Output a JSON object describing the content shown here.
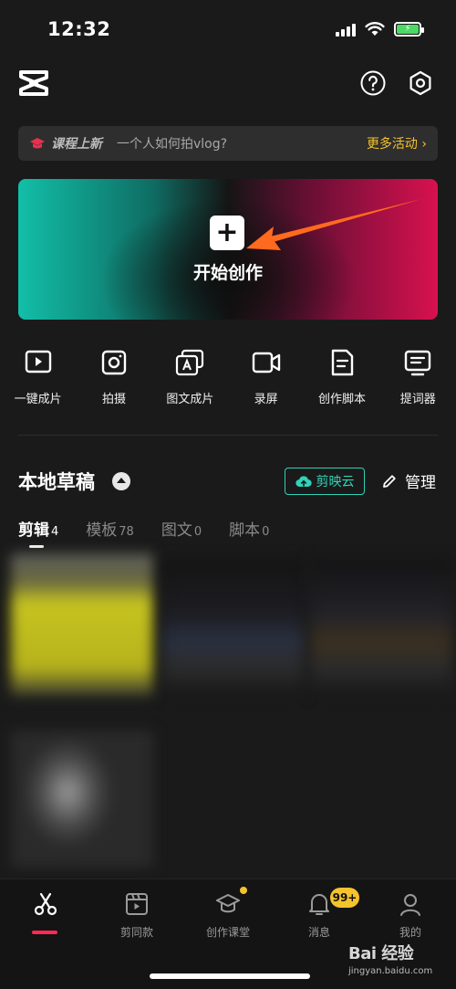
{
  "status_bar": {
    "time": "12:32",
    "battery_level": 0.85
  },
  "header": {
    "logo_icon": "capcut-logo-icon",
    "help_icon": "help-icon",
    "settings_icon": "settings-icon"
  },
  "banner": {
    "tag": "课程上新",
    "course": "一个人如何拍vlog?",
    "more": "更多活动 ›"
  },
  "create": {
    "plus": "+",
    "label": "开始创作"
  },
  "tools": [
    {
      "label": "一键成片",
      "icon": "play-icon"
    },
    {
      "label": "拍摄",
      "icon": "camera-icon"
    },
    {
      "label": "图文成片",
      "icon": "image-text-icon"
    },
    {
      "label": "录屏",
      "icon": "screen-record-icon"
    },
    {
      "label": "创作脚本",
      "icon": "script-icon"
    },
    {
      "label": "提词器",
      "icon": "teleprompter-icon"
    }
  ],
  "drafts": {
    "title": "本地草稿",
    "cloud": "剪映云",
    "manage": "管理",
    "tabs": [
      {
        "name": "剪辑",
        "count": "4"
      },
      {
        "name": "模板",
        "count": "78"
      },
      {
        "name": "图文",
        "count": "0"
      },
      {
        "name": "脚本",
        "count": "0"
      }
    ]
  },
  "bottom_nav": [
    {
      "label": "",
      "icon": "scissors-icon"
    },
    {
      "label": "剪同款",
      "icon": "template-icon"
    },
    {
      "label": "创作课堂",
      "icon": "graduation-cap-icon"
    },
    {
      "label": "消息",
      "icon": "bell-icon"
    },
    {
      "label": "我的",
      "icon": "profile-icon"
    }
  ],
  "badge": "99+",
  "watermark": {
    "logo": "Bai 经验",
    "url": "jingyan.baidu.com"
  },
  "colors": {
    "accent_teal": "#2fd3b8",
    "accent_yellow": "#f5c32c",
    "accent_red": "#fe2c55",
    "arrow_orange": "#ff6a1f"
  }
}
